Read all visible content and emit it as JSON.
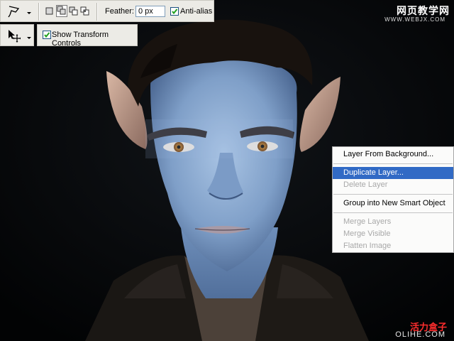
{
  "toolbar": {
    "feather_label": "Feather:",
    "feather_value": "0 px",
    "antialias_label": "Anti-alias",
    "antialias_checked": true,
    "show_transform_label": "Show Transform Controls",
    "show_transform_checked": true,
    "lasso_tool_icon": "polygonal-lasso-icon",
    "move_tool_icon": "move-tool-icon"
  },
  "context_menu": {
    "items": [
      {
        "label": "Layer From Background...",
        "state": "normal"
      },
      {
        "label": "Duplicate Layer...",
        "state": "selected"
      },
      {
        "label": "Delete Layer",
        "state": "disabled"
      },
      {
        "label": "Group into New Smart Object",
        "state": "normal"
      },
      {
        "label": "Merge Layers",
        "state": "disabled"
      },
      {
        "label": "Merge Visible",
        "state": "disabled"
      },
      {
        "label": "Flatten Image",
        "state": "disabled"
      }
    ]
  },
  "watermarks": {
    "top_cn": "网页教学网",
    "top_url": "WWW.WEBJX.COM",
    "bottom_cn": "活力盒子",
    "bottom_url": "OLIHE.COM"
  },
  "colors": {
    "toolbar_bg": "#ecebe6",
    "menu_highlight": "#316ac5",
    "skin_blue": "#8fb0d6"
  }
}
